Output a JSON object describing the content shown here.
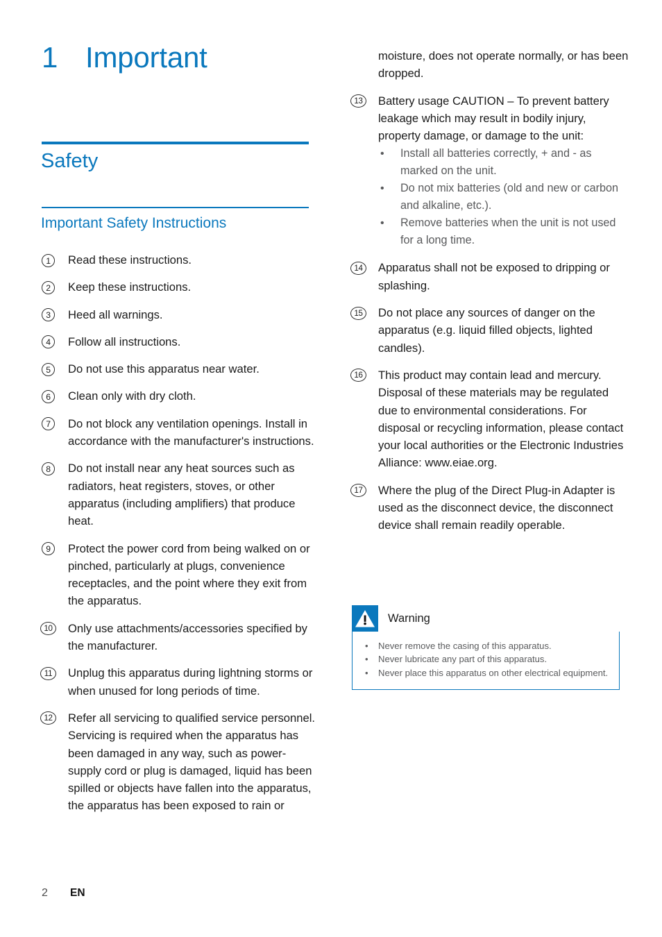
{
  "chapter": {
    "number": "1",
    "title": "Important"
  },
  "sections": {
    "safety": "Safety",
    "important_safety_instructions": "Important Safety Instructions"
  },
  "colors": {
    "accent_blue": "#0a78bd",
    "body_text": "#1a1a1a",
    "muted_text": "#58595b"
  },
  "left_column": {
    "items": [
      {
        "num": "1",
        "text": "Read these instructions."
      },
      {
        "num": "2",
        "text": "Keep these instructions."
      },
      {
        "num": "3",
        "text": "Heed all warnings."
      },
      {
        "num": "4",
        "text": "Follow all instructions."
      },
      {
        "num": "5",
        "text": "Do not use this apparatus near water."
      },
      {
        "num": "6",
        "text": "Clean only with dry cloth."
      },
      {
        "num": "7",
        "text": "Do not block any ventilation openings. Install in accordance with the manufacturer's instructions."
      },
      {
        "num": "8",
        "text": "Do not install near any heat sources such as radiators, heat registers, stoves, or other apparatus (including amplifiers) that produce heat."
      },
      {
        "num": "9",
        "text": "Protect the power cord from being walked on or pinched, particularly at plugs, convenience receptacles, and the point where they exit from the apparatus."
      },
      {
        "num": "10",
        "text": "Only use attachments/accessories specified by the manufacturer."
      },
      {
        "num": "11",
        "text": "Unplug this apparatus during lightning storms or when unused for long periods of time."
      },
      {
        "num": "12",
        "text": "Refer all servicing to qualified service personnel. Servicing is required when the apparatus has been damaged in any way, such as power-supply cord or plug is damaged, liquid has been spilled or objects have fallen into the apparatus, the apparatus has been exposed to rain or"
      }
    ]
  },
  "right_column": {
    "continuation": "moisture, does not operate normally, or has been dropped.",
    "item13": {
      "num": "13",
      "text": "Battery usage CAUTION – To prevent battery leakage which may result in bodily injury, property damage, or damage to the unit:",
      "subbullets": [
        "Install all batteries correctly, + and - as marked on the unit.",
        "Do not mix batteries (old and new or carbon and alkaline, etc.).",
        "Remove batteries when the unit is not used for a long time."
      ]
    },
    "items": [
      {
        "num": "14",
        "text": "Apparatus shall not be exposed to dripping or splashing."
      },
      {
        "num": "15",
        "text": "Do not place any sources of danger on the apparatus (e.g. liquid filled objects, lighted candles)."
      },
      {
        "num": "16",
        "text": "This product may contain lead and mercury. Disposal of these materials may be regulated due to environmental considerations. For disposal or recycling information, please contact your local authorities or the Electronic Industries Alliance: www.eiae.org."
      },
      {
        "num": "17",
        "text": "Where the plug of the Direct Plug-in Adapter is used as the disconnect device, the disconnect device shall remain readily operable."
      }
    ]
  },
  "warning": {
    "title": "Warning",
    "icon": "warning-triangle-icon",
    "bullets": [
      "Never remove the casing of this apparatus.",
      "Never lubricate any part of this apparatus.",
      "Never place this apparatus on other electrical equipment."
    ]
  },
  "footer": {
    "page_number": "2",
    "language": "EN"
  }
}
